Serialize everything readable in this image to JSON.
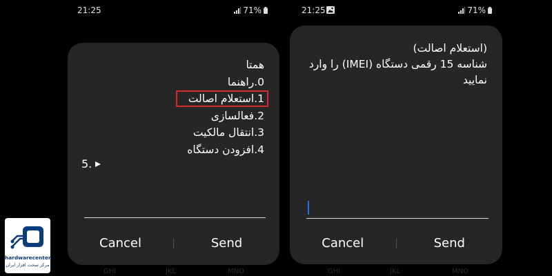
{
  "left_screen": {
    "status": {
      "time": "21:25",
      "battery": "71%"
    },
    "background_keypad_labels": [
      "GHI",
      "JKL",
      "MNO"
    ],
    "menu": {
      "title": "همتا",
      "items": [
        {
          "num": "0.",
          "label": "راهنما"
        },
        {
          "num": "1.",
          "label": "استعلام اصالت",
          "highlighted": true
        },
        {
          "num": "2.",
          "label": "فعالسازی"
        },
        {
          "num": "3.",
          "label": "انتقال مالکیت"
        },
        {
          "num": "4.",
          "label": "افزودن دستگاه"
        }
      ],
      "more_item": "5."
    },
    "cancel_label": "Cancel",
    "send_label": "Send"
  },
  "right_screen": {
    "status": {
      "time": "21:25",
      "battery": "71%"
    },
    "background_keypad_labels": [
      "GHI",
      "JKL",
      "MNO"
    ],
    "prompt_title": "(استعلام اصالت)",
    "prompt_body": "شناسه 15 رقمی دستگاه (IMEI) را وارد نمایید",
    "input_value": "",
    "cancel_label": "Cancel",
    "send_label": "Send"
  },
  "logo": {
    "brand": "hardwarecenter.ir",
    "tagline": "مرکز سخت افزار ایران"
  },
  "colors": {
    "dialog_bg": "#262626",
    "highlight": "#d8262d",
    "cursor": "#1a73e8",
    "brand": "#0a3d78"
  }
}
